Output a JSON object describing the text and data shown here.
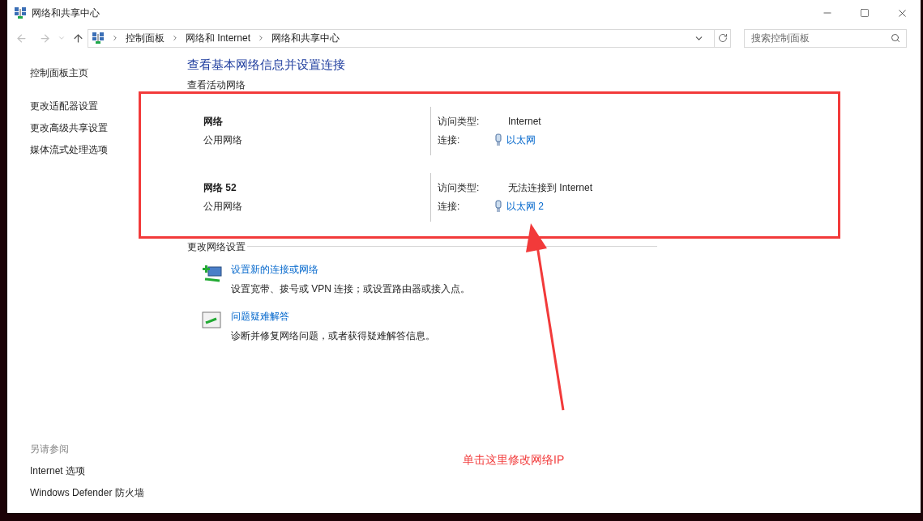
{
  "window": {
    "title": "网络和共享中心"
  },
  "breadcrumb": [
    "控制面板",
    "网络和 Internet",
    "网络和共享中心"
  ],
  "search": {
    "placeholder": "搜索控制面板"
  },
  "sidebar": {
    "items": [
      "控制面板主页",
      "更改适配器设置",
      "更改高级共享设置",
      "媒体流式处理选项"
    ],
    "see_also": {
      "heading": "另请参阅",
      "items": [
        "Internet 选项",
        "Windows Defender 防火墙"
      ]
    }
  },
  "main": {
    "title": "查看基本网络信息并设置连接",
    "active_heading": "查看活动网络",
    "networks": [
      {
        "name": "网络",
        "category": "公用网络",
        "access_label": "访问类型:",
        "access": "Internet",
        "conn_label": "连接:",
        "connection": "以太网"
      },
      {
        "name": "网络 52",
        "category": "公用网络",
        "access_label": "访问类型:",
        "access": "无法连接到 Internet",
        "conn_label": "连接:",
        "connection": "以太网 2"
      }
    ],
    "settings_heading": "更改网络设置",
    "tasks": [
      {
        "kind": "new-connection",
        "title": "设置新的连接或网络",
        "desc": "设置宽带、拨号或 VPN 连接；或设置路由器或接入点。"
      },
      {
        "kind": "troubleshoot",
        "title": "问题疑难解答",
        "desc": "诊断并修复网络问题，或者获得疑难解答信息。"
      }
    ]
  },
  "annotation": {
    "text": "单击这里修改网络IP"
  }
}
